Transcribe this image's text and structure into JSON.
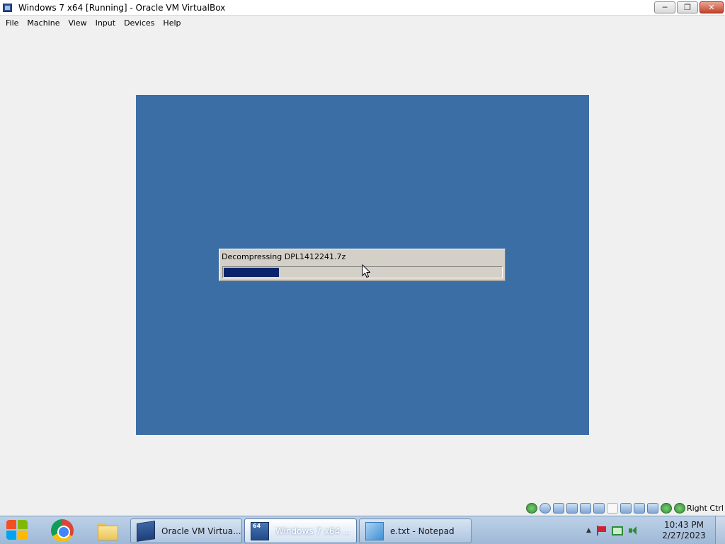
{
  "window": {
    "title": "Windows 7 x64  [Running] - Oracle VM VirtualBox",
    "icon": "virtualbox-icon"
  },
  "menubar": {
    "items": [
      "File",
      "Machine",
      "View",
      "Input",
      "Devices",
      "Help"
    ]
  },
  "vm_screen": {
    "background_color": "#3b6ea5",
    "progress_dialog": {
      "label": "Decompressing DPL1412241.7z",
      "progress_fraction": 0.2
    }
  },
  "vbox_status_bar": {
    "icons": [
      "hard-disk-icon",
      "optical-drive-icon",
      "audio-icon",
      "network-icon",
      "usb-icon",
      "shared-folders-icon",
      "display-icon",
      "video-capture-icon",
      "recording-icon",
      "cpu-icon",
      "virtualization-icon",
      "mouse-integration-icon"
    ],
    "host_key_label": "Right Ctrl"
  },
  "taskbar": {
    "pinned": [
      "chrome-icon",
      "file-explorer-icon"
    ],
    "buttons": [
      {
        "label": "Oracle VM Virtua...",
        "icon": "virtualbox-icon",
        "active": false
      },
      {
        "label": "Windows 7 x64 ...",
        "icon": "xp-vm-icon",
        "active": true
      },
      {
        "label": "e.txt - Notepad",
        "icon": "notepad-icon",
        "active": false
      }
    ],
    "xp_icon_text": "64",
    "clock": {
      "time": "10:43 PM",
      "date": "2/27/2023"
    }
  }
}
